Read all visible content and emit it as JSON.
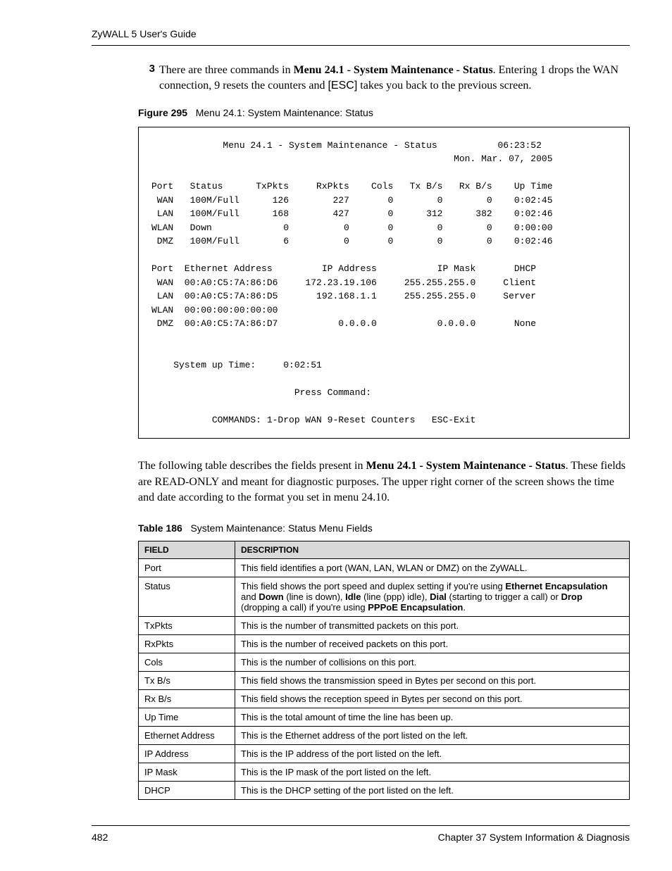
{
  "header": {
    "title": "ZyWALL 5 User's Guide"
  },
  "step": {
    "number": "3",
    "pre": "There are three commands in ",
    "bold1": "Menu 24.1 - System Maintenance - Status",
    "mid": ". Entering 1 drops the WAN connection, 9 resets the counters and ",
    "esc": "[ESC]",
    "post": " takes you back to the previous screen."
  },
  "figure": {
    "label": "Figure 295",
    "caption": "Menu 24.1: System Maintenance: Status"
  },
  "terminal": {
    "title_line": "             Menu 24.1 - System Maintenance - Status           06:23:52",
    "date_line": "                                                       Mon. Mar. 07, 2005",
    "stats_header": "Port   Status      TxPkts     RxPkts    Cols   Tx B/s   Rx B/s    Up Time",
    "stats_rows": [
      " WAN   100M/Full      126        227       0        0        0    0:02:45",
      " LAN   100M/Full      168        427       0      312      382    0:02:46",
      "WLAN   Down             0          0       0        0        0    0:00:00",
      " DMZ   100M/Full        6          0       0        0        0    0:02:46"
    ],
    "addr_header": "Port  Ethernet Address         IP Address           IP Mask       DHCP",
    "addr_rows": [
      " WAN  00:A0:C5:7A:86:D6     172.23.19.106     255.255.255.0     Client",
      " LAN  00:A0:C5:7A:86:D5       192.168.1.1     255.255.255.0     Server",
      "WLAN  00:00:00:00:00:00",
      " DMZ  00:A0:C5:7A:86:D7           0.0.0.0           0.0.0.0       None"
    ],
    "uptime": "    System up Time:     0:02:51",
    "press": "                          Press Command:",
    "commands": "           COMMANDS: 1-Drop WAN 9-Reset Counters   ESC-Exit"
  },
  "para2": {
    "pre": "The following table describes the fields present in ",
    "bold": "Menu 24.1 - System Maintenance - Status",
    "post": ". These fields are READ-ONLY and meant for diagnostic purposes. The upper right corner of the screen shows the time and date according to the format you set in menu 24.10."
  },
  "table": {
    "label": "Table 186",
    "caption": "System Maintenance: Status Menu Fields",
    "head": {
      "field": "FIELD",
      "desc": "DESCRIPTION"
    },
    "rows": [
      {
        "field": "Port",
        "desc_plain": "This field identifies a port (WAN, LAN, WLAN or DMZ) on the ZyWALL."
      },
      {
        "field": "Status",
        "desc_html": "This field shows the port speed and duplex setting if you're using <b>Ethernet Encapsulation</b> and <b>Down</b> (line is down), <b>Idle</b> (line (ppp) idle), <b>Dial</b> (starting to trigger a call) or <b>Drop</b> (dropping a call) if you're using <b>PPPoE Encapsulation</b>."
      },
      {
        "field": "TxPkts",
        "desc_plain": "This is the number of transmitted packets on this port."
      },
      {
        "field": "RxPkts",
        "desc_plain": "This is the number of received packets on this port."
      },
      {
        "field": "Cols",
        "desc_plain": "This is the number of collisions on this port."
      },
      {
        "field": "Tx B/s",
        "desc_plain": "This field shows the transmission speed in Bytes per second on this port."
      },
      {
        "field": "Rx B/s",
        "desc_plain": "This field shows the reception speed in Bytes per second on this port."
      },
      {
        "field": "Up Time",
        "desc_plain": "This is the total amount of time the line has been up."
      },
      {
        "field": "Ethernet Address",
        "desc_plain": "This is the Ethernet address of the port listed on the left."
      },
      {
        "field": "IP Address",
        "desc_plain": "This is the IP address of the port listed on the left."
      },
      {
        "field": "IP Mask",
        "desc_plain": "This is the IP mask of the port listed on the left."
      },
      {
        "field": "DHCP",
        "desc_plain": "This is the DHCP setting of the port listed on the left."
      }
    ]
  },
  "footer": {
    "page": "482",
    "chapter": "Chapter 37 System Information & Diagnosis"
  }
}
